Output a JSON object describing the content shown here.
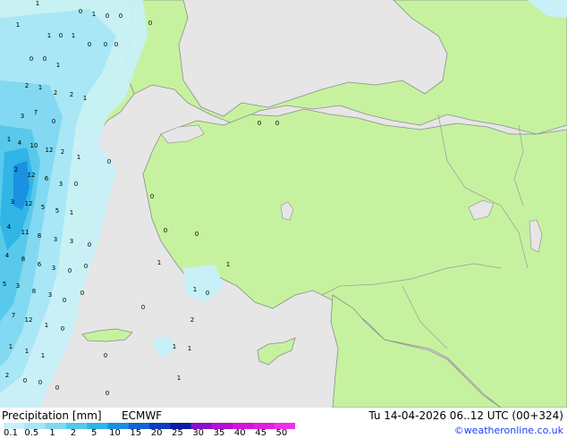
{
  "legend": {
    "title": "Precipitation [mm]",
    "model": "ECMWF",
    "valid_time": "Tu 14-04-2026 06..12 UTC (00+324)",
    "credit": "©weatheronline.co.uk",
    "ticks": [
      "0.1",
      "0.5",
      "1",
      "2",
      "5",
      "10",
      "15",
      "20",
      "25",
      "30",
      "35",
      "40",
      "45",
      "50"
    ],
    "colors": [
      "#c8f0f8",
      "#a8e6f5",
      "#7fd8f0",
      "#56c8ea",
      "#2eb4e6",
      "#1a8fe0",
      "#1464d2",
      "#0f3cbe",
      "#0a1ea0",
      "#8a10c8",
      "#b010d0",
      "#d014d8",
      "#e21ce0",
      "#f030e8"
    ]
  },
  "map_colors": {
    "sea": "#e6e6e6",
    "land": "#c6f2a0",
    "border": "#9a9a9a",
    "coast": "#8c8c8c"
  },
  "labels": [
    {
      "text": "1"
    },
    {
      "text": "0"
    },
    {
      "text": "1"
    },
    {
      "text": "0"
    },
    {
      "text": "0"
    },
    {
      "text": "0"
    },
    {
      "text": "1"
    },
    {
      "text": "1"
    },
    {
      "text": "0"
    },
    {
      "text": "1"
    },
    {
      "text": "0"
    },
    {
      "text": "0"
    },
    {
      "text": "0"
    },
    {
      "text": "0"
    },
    {
      "text": "0"
    },
    {
      "text": "1"
    },
    {
      "text": "2"
    },
    {
      "text": "1"
    },
    {
      "text": "2"
    },
    {
      "text": "1"
    },
    {
      "text": "2"
    },
    {
      "text": "7"
    },
    {
      "text": "3"
    },
    {
      "text": "0"
    },
    {
      "text": "1"
    },
    {
      "text": "4"
    },
    {
      "text": "10"
    },
    {
      "text": "12"
    },
    {
      "text": "2"
    },
    {
      "text": "1"
    },
    {
      "text": "2"
    },
    {
      "text": "12"
    },
    {
      "text": "6"
    },
    {
      "text": "3"
    },
    {
      "text": "0"
    },
    {
      "text": "3"
    },
    {
      "text": "12"
    },
    {
      "text": "5"
    },
    {
      "text": "5"
    },
    {
      "text": "1"
    },
    {
      "text": "4"
    },
    {
      "text": "11"
    },
    {
      "text": "8"
    },
    {
      "text": "3"
    },
    {
      "text": "3"
    },
    {
      "text": "0"
    },
    {
      "text": "4"
    },
    {
      "text": "8"
    },
    {
      "text": "6"
    },
    {
      "text": "3"
    },
    {
      "text": "0"
    },
    {
      "text": "5"
    },
    {
      "text": "3"
    },
    {
      "text": "8"
    },
    {
      "text": "3"
    },
    {
      "text": "0"
    },
    {
      "text": "7"
    },
    {
      "text": "12"
    },
    {
      "text": "1"
    },
    {
      "text": "0"
    },
    {
      "text": "1"
    },
    {
      "text": "1"
    },
    {
      "text": "1"
    },
    {
      "text": "2"
    },
    {
      "text": "0"
    },
    {
      "text": "0"
    },
    {
      "text": "0"
    },
    {
      "text": "1"
    },
    {
      "text": "0"
    },
    {
      "text": "0"
    },
    {
      "text": "0"
    },
    {
      "text": "1"
    },
    {
      "text": "2"
    },
    {
      "text": "1"
    },
    {
      "text": "1"
    },
    {
      "text": "0"
    },
    {
      "text": "0"
    },
    {
      "text": "0"
    },
    {
      "text": "0"
    },
    {
      "text": "1"
    },
    {
      "text": "0"
    },
    {
      "text": "1"
    },
    {
      "text": "0"
    },
    {
      "text": "0"
    },
    {
      "text": "0"
    },
    {
      "text": "0"
    }
  ]
}
